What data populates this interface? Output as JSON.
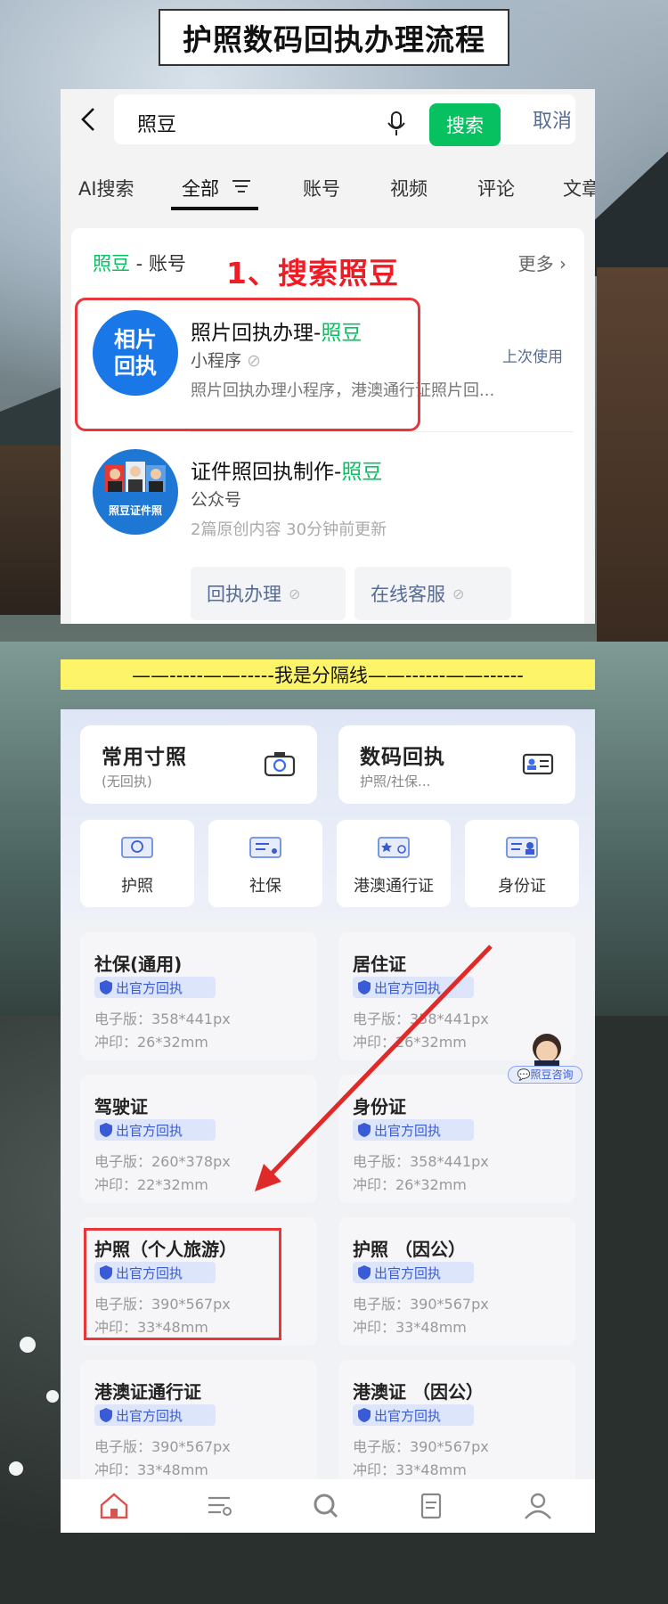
{
  "page_title": "护照数码回执办理流程",
  "search": {
    "query": "照豆",
    "search_btn": "搜索",
    "cancel": "取消",
    "tabs": [
      "AI搜索",
      "全部",
      "账号",
      "视频",
      "评论",
      "文章"
    ],
    "section_brand": "照豆",
    "section_suffix": " - 账号",
    "more": "更多",
    "annotation": "1、搜索照豆",
    "result1": {
      "logo_text_line1": "相片",
      "logo_text_line2": "回执",
      "title_prefix": "照片回执办理-",
      "title_brand": "照豆",
      "type": "小程序",
      "last_used": "上次使用",
      "desc": "照片回执办理小程序，港澳通行证照片回..."
    },
    "result2": {
      "logo_caption": "照豆证件照",
      "title_prefix": "证件照回执制作-",
      "title_brand": "照豆",
      "type": "公众号",
      "meta": "2篇原创内容  30分钟前更新",
      "link1": "回执办理",
      "link2": "在线客服"
    }
  },
  "separator": "——-----——-----我是分隔线——------——------",
  "app": {
    "card_common": {
      "title": "常用寸照",
      "sub": "(无回执)"
    },
    "card_digital": {
      "title": "数码回执",
      "sub": "护照/社保..."
    },
    "quick": [
      "护照",
      "社保",
      "港澳通行证",
      "身份证"
    ],
    "badge": "出官方回执",
    "sizes": [
      {
        "name": "社保(通用)",
        "e": "电子版：358*441px",
        "p": "冲印：26*32mm"
      },
      {
        "name": "居住证",
        "e": "电子版：358*441px",
        "p": "冲印：26*32mm"
      },
      {
        "name": "驾驶证",
        "e": "电子版：260*378px",
        "p": "冲印：22*32mm"
      },
      {
        "name": "身份证",
        "e": "电子版：358*441px",
        "p": "冲印：26*32mm"
      },
      {
        "name": "护照（个人旅游）",
        "e": "电子版：390*567px",
        "p": "冲印：33*48mm"
      },
      {
        "name": "护照 （因公）",
        "e": "电子版：390*567px",
        "p": "冲印：33*48mm"
      },
      {
        "name": "港澳证通行证",
        "e": "电子版：390*567px",
        "p": "冲印：33*48mm"
      },
      {
        "name": "港澳证 （因公）",
        "e": "电子版：390*567px",
        "p": "冲印：33*48mm"
      }
    ],
    "consult": "照豆咨询",
    "nav_icons": [
      "home-icon",
      "list-icon",
      "search-icon",
      "document-icon",
      "profile-icon"
    ]
  },
  "colors": {
    "accent_green": "#07c160",
    "link_blue": "#576b95",
    "annotation_red": "#ee1c25",
    "badge_blue": "#3a5bd6"
  }
}
